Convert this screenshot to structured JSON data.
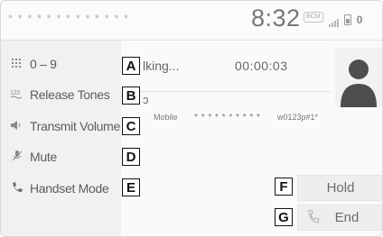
{
  "status_bar": {
    "masked_name": "* * * * * * * * * * * * *",
    "clock": "8:32",
    "camera_badge": "BCM",
    "icons": [
      "camera-badge-icon",
      "signal-icon",
      "battery-icon",
      "zero-icon"
    ],
    "zero_glyph": "0"
  },
  "menu": {
    "items": [
      {
        "icon": "keypad-icon",
        "label": "0 – 9"
      },
      {
        "icon": "release-tones-icon",
        "label": "Release Tones"
      },
      {
        "icon": "speaker-volume-icon",
        "label": "Transmit Volume"
      },
      {
        "icon": "microphone-mute-icon",
        "label": "Mute"
      },
      {
        "icon": "handset-icon",
        "label": "Handset Mode"
      }
    ]
  },
  "call": {
    "status": "lking...",
    "partial_char": "ɔ",
    "timer": "00:00:03",
    "phone_type": "Mobile",
    "phone_number_masked": "* * * * * * * * * *",
    "dial_string": "w0123p#1*"
  },
  "buttons": {
    "hold_label": "Hold",
    "end_label": "End"
  },
  "callouts": [
    "A",
    "B",
    "C",
    "D",
    "E",
    "F",
    "G"
  ],
  "colors": {
    "panel_bg": "#f1f1f1",
    "text": "#5c5c5c",
    "callout_border": "#111111"
  }
}
